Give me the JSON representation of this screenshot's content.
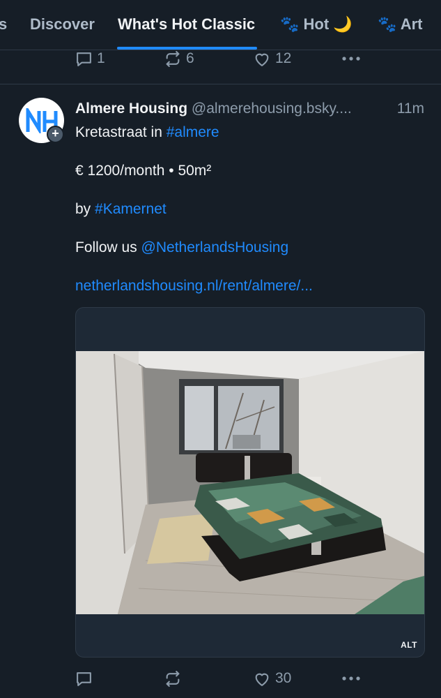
{
  "tabs": [
    {
      "label": "s"
    },
    {
      "label": "Discover"
    },
    {
      "label": "What's Hot Classic"
    },
    {
      "label": "🐾 Hot 🌙"
    },
    {
      "label": "🐾 Art"
    }
  ],
  "active_tab": "What's Hot Classic",
  "prev_post": {
    "reply_count": "1",
    "repost_count": "6",
    "like_count": "12"
  },
  "post": {
    "author": "Almere Housing",
    "handle": "@almerehousing.bsky....",
    "time": "11m",
    "avatar_text": "NH",
    "line1_text": "Kretastraat in ",
    "line1_tag": "#almere",
    "price": "€ 1200/month • 50m²",
    "by_text": "by ",
    "by_tag": "#Kamernet",
    "follow_text": "Follow us ",
    "follow_mention": "@NetherlandsHousing",
    "link": "netherlandshousing.nl/rent/almere/...",
    "alt_label": "ALT",
    "reply_count": "",
    "repost_count": "",
    "like_count": "30"
  },
  "colors": {
    "background": "#161e27",
    "accent": "#208bfe",
    "muted": "#8d9cab"
  }
}
